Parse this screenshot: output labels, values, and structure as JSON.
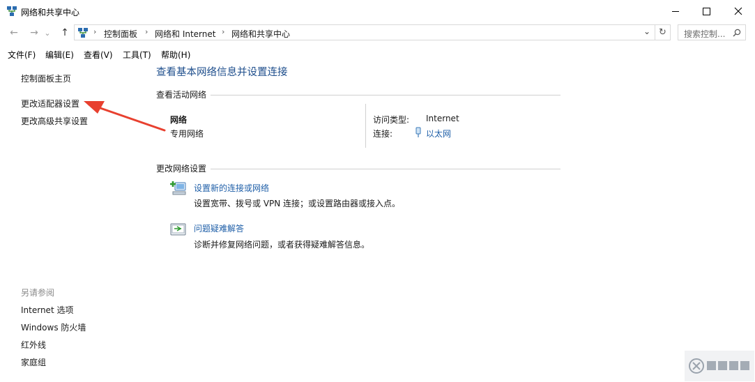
{
  "window": {
    "title": "网络和共享中心",
    "minimize_glyph": "—",
    "maximize_glyph": "☐",
    "close_glyph": "✕"
  },
  "nav": {
    "back_glyph": "←",
    "forward_glyph": "→",
    "recent_glyph": "⌄",
    "up_glyph": "↑",
    "breadcrumb": [
      "控制面板",
      "网络和 Internet",
      "网络和共享中心"
    ],
    "separator": "›",
    "dropdown_glyph": "⌄",
    "refresh_glyph": "↻",
    "search_placeholder": "搜索控制..."
  },
  "menu": [
    "文件(F)",
    "编辑(E)",
    "查看(V)",
    "工具(T)",
    "帮助(H)"
  ],
  "left_pane": {
    "links": [
      "控制面板主页",
      "更改适配器设置",
      "更改高级共享设置"
    ],
    "see_also_title": "另请参阅",
    "see_also": [
      "Internet 选项",
      "Windows 防火墙",
      "红外线",
      "家庭组"
    ]
  },
  "main": {
    "title": "查看基本网络信息并设置连接",
    "active_networks_title": "查看活动网络",
    "network": {
      "name": "网络",
      "category": "专用网络",
      "access_type_label": "访问类型:",
      "access_type_value": "Internet",
      "connection_label": "连接:",
      "connection_value": "以太网"
    },
    "change_settings_title": "更改网络设置",
    "tasks": [
      {
        "title": "设置新的连接或网络",
        "desc": "设置宽带、拨号或 VPN 连接；或设置路由器或接入点。"
      },
      {
        "title": "问题疑难解答",
        "desc": "诊断并修复网络问题，或者获得疑难解答信息。"
      }
    ]
  },
  "colors": {
    "accent_title": "#1e4e8c",
    "link": "#1f5fa8",
    "annotation_arrow": "#e8402f"
  }
}
